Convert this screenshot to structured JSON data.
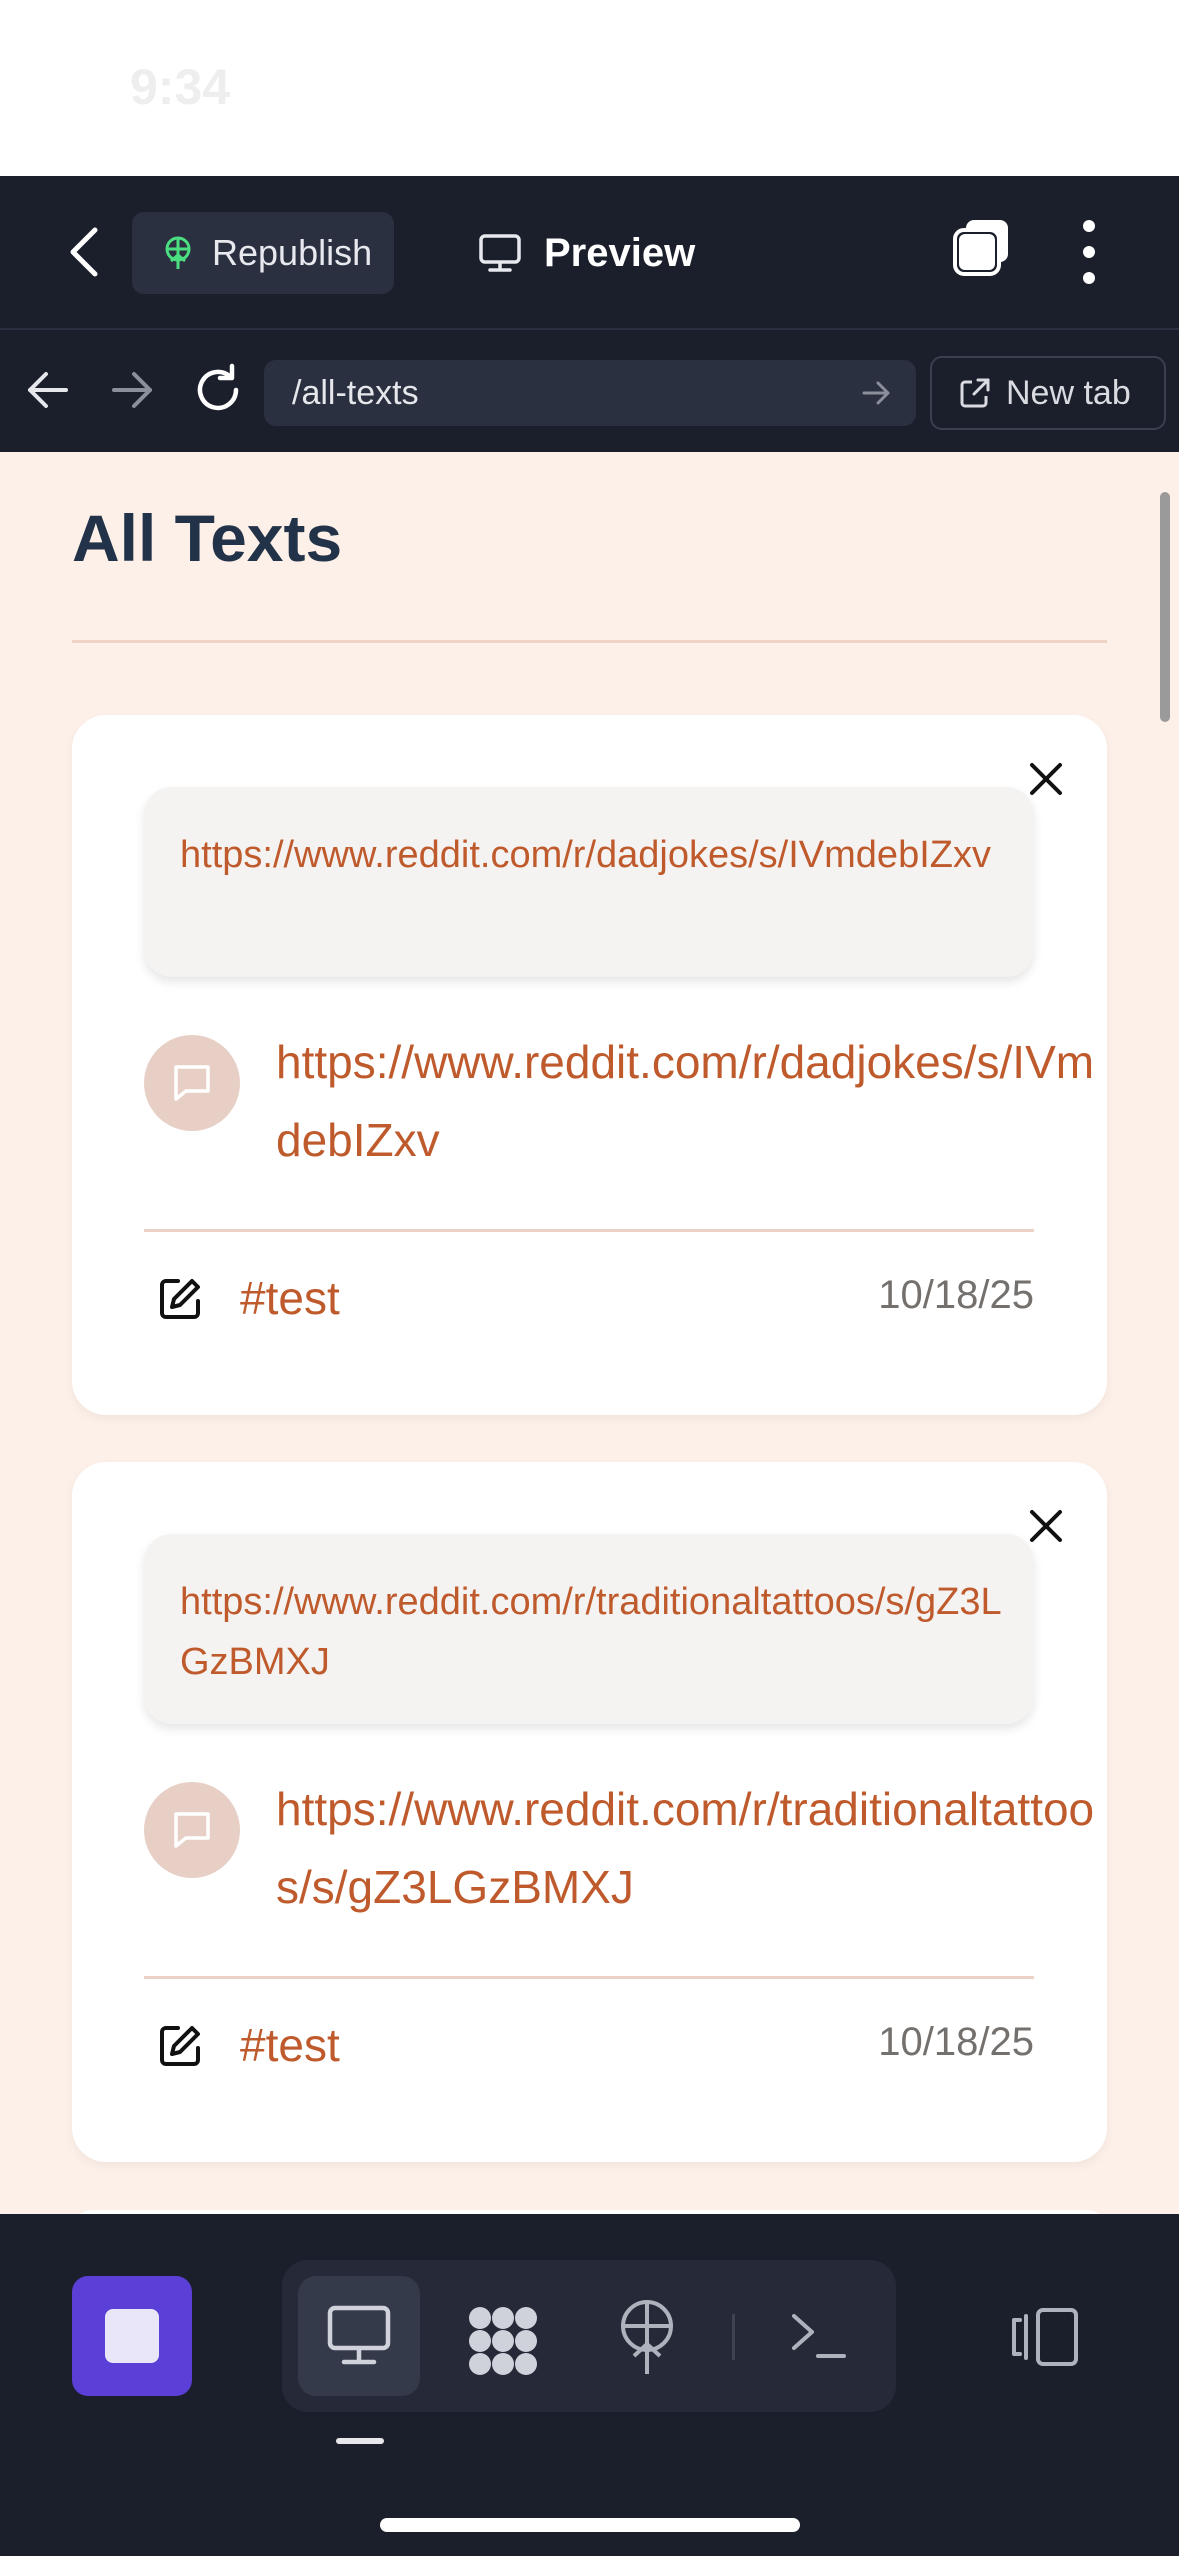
{
  "status_bar": {
    "time": "9:34"
  },
  "toolbar": {
    "republish_label": "Republish",
    "preview_label": "Preview"
  },
  "browser": {
    "url": "/all-texts",
    "new_tab_label": "New tab"
  },
  "page": {
    "title": "All Texts",
    "cards": [
      {
        "quote": "https://www.reddit.com/r/dadjokes/s/IVmdebIZxv",
        "body": "https://www.reddit.com/r/dadjokes/s/IVmdebIZxv",
        "tag": "#test",
        "date": "10/18/25"
      },
      {
        "quote": "https://www.reddit.com/r/traditionaltattoos/s/gZ3LGzBMXJ",
        "body": "https://www.reddit.com/r/traditionaltattoos/s/gZ3LGzBMXJ",
        "tag": "#test",
        "date": "10/18/25"
      }
    ]
  },
  "colors": {
    "toolbar_bg": "#1b1f2c",
    "content_bg": "#fdf0e9",
    "accent_text": "#bf5a2c",
    "title_text": "#223349",
    "stop_button": "#5b3fd6"
  },
  "icons": {
    "back": "chevron-left-icon",
    "republish": "publish-tree-icon",
    "preview": "monitor-icon",
    "copy": "copy-icon",
    "more": "vertical-ellipsis-icon",
    "close": "close-icon",
    "comment": "comment-icon",
    "edit": "edit-icon"
  }
}
